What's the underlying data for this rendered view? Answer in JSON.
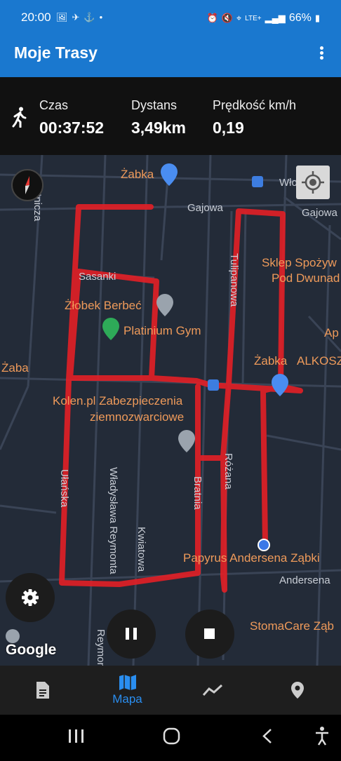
{
  "status_bar": {
    "time": "20:00",
    "network": "LTE+",
    "battery": "66%"
  },
  "app": {
    "title": "Moje Trasy"
  },
  "stats": [
    {
      "label": "Czas",
      "value": "00:37:52"
    },
    {
      "label": "Dystans",
      "value": "3,49km"
    },
    {
      "label": "Prędkość km/h",
      "value": "0,19"
    }
  ],
  "map": {
    "places": {
      "zabka_top": "Żabka",
      "sklep_1": "Sklep Spożyw",
      "sklep_2": "Pod Dwunad",
      "zlobek": "Żłobek Berbeć",
      "gym": "Platinium Gym",
      "zaba": "Żaba",
      "zabka_mid": "Żabka",
      "alkosz": "ALKOSZ",
      "ap": "Ap",
      "kolen_1": "Kolen.pl Zabezpieczenia",
      "kolen_2": "ziemnozwarciowe",
      "papyrus": "Papyrus Andersena Ząbki",
      "stomacare": "StomaCare Ząb"
    },
    "streets": {
      "wlad": "Włodawa",
      "gajowa1": "Gajowa",
      "gajowa2": "Gajowa",
      "sasanki": "Sasanki",
      "tulipanowa": "Tulipanowa",
      "rozana": "Różana",
      "bratnia": "Bratnia",
      "kwiatowa": "Kwiatowa",
      "reymonta": "Władysława Reymonta",
      "reymonta2": "Reymonta",
      "ulanska": "Ułańska",
      "andersena": "Andersena",
      "rutnicza": "Rutnicza"
    },
    "attribution": "Google"
  },
  "bottom_nav": [
    {
      "icon": "document-icon",
      "label": ""
    },
    {
      "icon": "map-icon",
      "label": "Mapa"
    },
    {
      "icon": "chart-line-icon",
      "label": ""
    },
    {
      "icon": "location-pin-icon",
      "label": ""
    }
  ],
  "colors": {
    "primary": "#1a78cf",
    "route": "#e01f26",
    "map_bg": "#232b38",
    "poi_label": "#ee9a5a",
    "active_nav": "#2a8ef0"
  }
}
